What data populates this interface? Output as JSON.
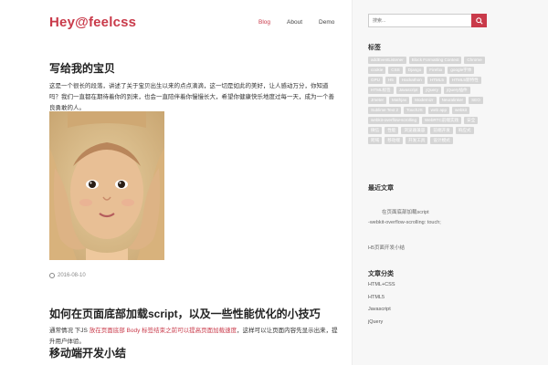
{
  "header": {
    "logo": "Hey@feelcss",
    "nav": [
      "Blog",
      "About",
      "Demo"
    ]
  },
  "posts": [
    {
      "title": "写给我的宝贝",
      "excerpt": "这是一个很长的段落，讲述了关于宝贝出生以来的点点滴滴，这一切是如此的美好，让人感动万分，你知道吗？我们一直都在期待着你的到来，也会一直陪伴着你慢慢长大，希望你健康快乐地度过每一天，成为一个善良勇敢的人。",
      "date": "2016-08-10"
    },
    {
      "title": "如何在页面底部加载script，以及一些性能优化的小技巧",
      "excerpt_pre": "通常情况 下JS ",
      "excerpt_hl": "放在页面底部 Body 标签结束之前可以提高页面加载速度",
      "excerpt_post": "，这样可以让页面内容先显示出来，提升用户体验。"
    },
    {
      "title": "移动端开发小结"
    }
  ],
  "sidebar": {
    "search_placeholder": "搜索...",
    "tags_heading": "标签",
    "tags": [
      "addEventListener",
      "Block Formatting Context",
      "Chrome",
      "cookie",
      "CSS",
      "Django",
      "Firefox",
      "google字体",
      "GPU",
      "H5",
      "Hackathon",
      "HTML5",
      "HTML5新特性",
      "HTML标签",
      "Javascript",
      "jQuery",
      "jQuery插件",
      "Jmeter",
      "Mathjax",
      "Modernizr",
      "Neuralinker",
      "SEO",
      "Sublime Text 2",
      "TouchJS",
      "web app",
      "webkit",
      "webkit-overflow-scrolling",
      "WebRTC前端实践",
      "安全",
      "微信",
      "性能",
      "浏览器兼容",
      "前端开发",
      "响应式",
      "跨域",
      "移动端",
      "开发工具",
      "设计模式"
    ],
    "recent_heading": "最近文章",
    "recent_items": [
      "在页面底部加载script",
      "-webkit-overflow-scrolling: touch;",
      "H5页面开发小结"
    ],
    "categories_heading": "文章分类",
    "categories": [
      "HTML+CSS",
      "HTML5",
      "Javascript",
      "jQuery"
    ]
  },
  "colors": {
    "accent": "#c93a4a",
    "tag_bg": "#d5d5d5",
    "sidebar_bg": "#f7f7f7"
  }
}
